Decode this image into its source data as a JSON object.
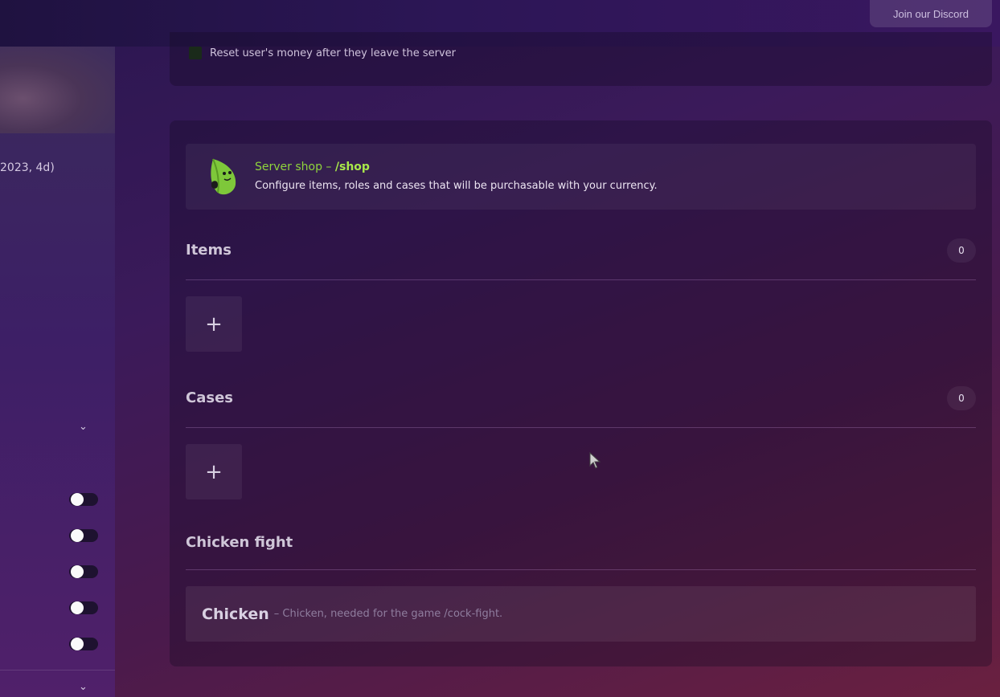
{
  "header": {
    "discord_label": "Join our Discord"
  },
  "sidebar": {
    "partial_text": "2023, 4d)",
    "toggles": [
      {
        "on": true
      },
      {
        "on": true
      },
      {
        "on": true
      },
      {
        "on": true
      },
      {
        "on": true
      }
    ]
  },
  "settings": {
    "reset_money_label": "Reset user's money after they leave the server",
    "reset_money_checked": false
  },
  "shop": {
    "title": "Server shop – ",
    "command": "/shop",
    "description": "Configure items, roles and cases that will be purchasable with your currency.",
    "leaf_icon": "leaf-mascot-icon"
  },
  "sections": {
    "items": {
      "title": "Items",
      "count": "0",
      "add_label": "+"
    },
    "cases": {
      "title": "Cases",
      "count": "0",
      "add_label": "+"
    },
    "chicken_fight": {
      "title": "Chicken fight",
      "item_name": "Chicken",
      "item_desc": "– Chicken, needed for the game /cock-fight."
    }
  },
  "colors": {
    "accent_green": "#8fd43c",
    "background_start": "#2a1650",
    "background_end": "#6a2040"
  }
}
